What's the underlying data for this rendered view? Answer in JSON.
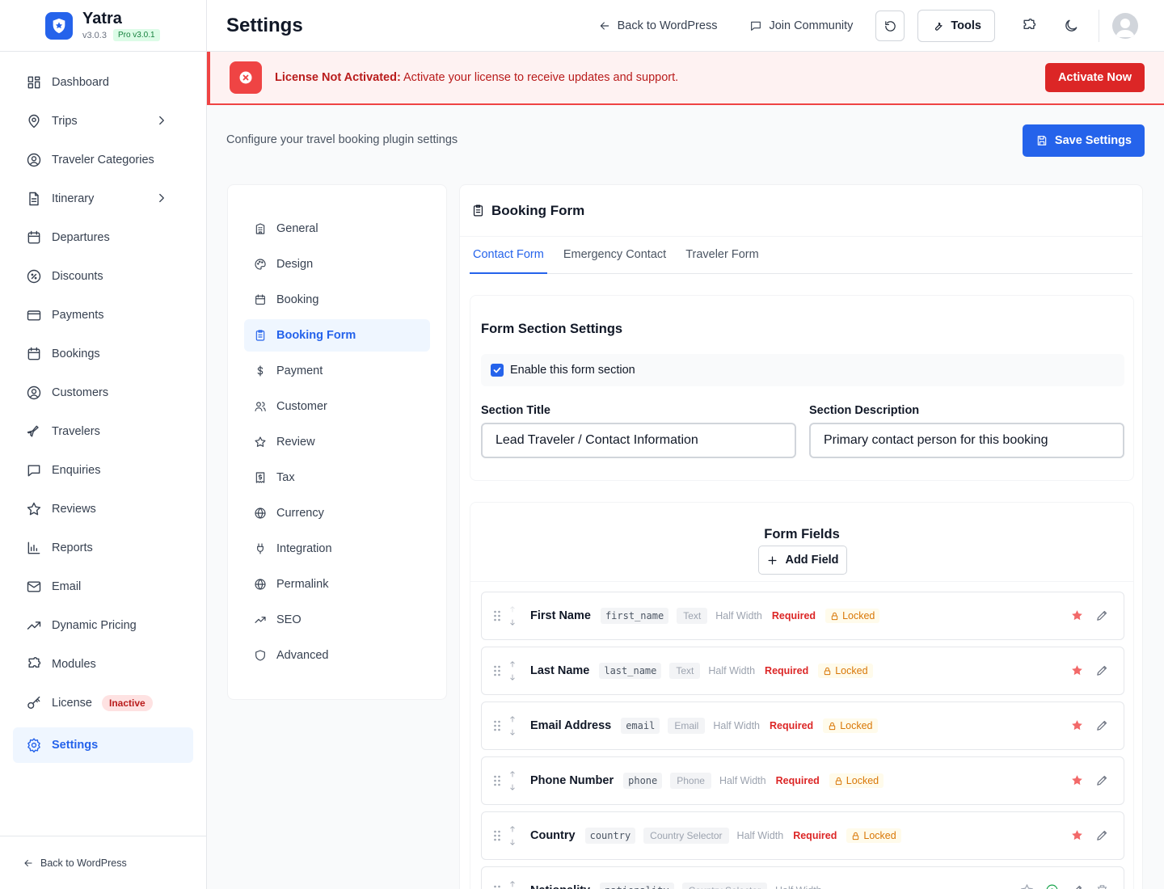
{
  "brand": {
    "name": "Yatra",
    "version": "v3.0.3",
    "pro": "Pro v3.0.1"
  },
  "sidebar": {
    "items": [
      {
        "label": "Dashboard",
        "icon": "dashboard-icon"
      },
      {
        "label": "Trips",
        "icon": "location-pin-icon",
        "chevron": true
      },
      {
        "label": "Traveler Categories",
        "icon": "user-circle-icon"
      },
      {
        "label": "Itinerary",
        "icon": "document-icon",
        "chevron": true
      },
      {
        "label": "Departures",
        "icon": "calendar-icon"
      },
      {
        "label": "Discounts",
        "icon": "discount-icon"
      },
      {
        "label": "Payments",
        "icon": "credit-card-icon"
      },
      {
        "label": "Bookings",
        "icon": "calendar-icon"
      },
      {
        "label": "Customers",
        "icon": "user-circle-icon"
      },
      {
        "label": "Travelers",
        "icon": "plane-icon"
      },
      {
        "label": "Enquiries",
        "icon": "message-icon"
      },
      {
        "label": "Reviews",
        "icon": "star-icon"
      },
      {
        "label": "Reports",
        "icon": "bar-chart-icon"
      },
      {
        "label": "Email",
        "icon": "mail-icon"
      },
      {
        "label": "Dynamic Pricing",
        "icon": "trend-icon"
      },
      {
        "label": "Modules",
        "icon": "puzzle-icon"
      },
      {
        "label": "License",
        "icon": "key-icon",
        "badge": "Inactive"
      },
      {
        "label": "Settings",
        "icon": "gear-icon",
        "active": true
      }
    ],
    "footer": "Back to WordPress"
  },
  "topbar": {
    "title": "Settings",
    "back": "Back to WordPress",
    "community": "Join Community",
    "tools": "Tools"
  },
  "alert": {
    "title": "License Not Activated:",
    "message": " Activate your license to receive updates and support.",
    "button": "Activate Now"
  },
  "main": {
    "subtitle": "Configure your travel booking plugin settings",
    "save": "Save Settings"
  },
  "settings_nav": [
    {
      "label": "General",
      "icon": "building-icon"
    },
    {
      "label": "Design",
      "icon": "palette-icon"
    },
    {
      "label": "Booking",
      "icon": "calendar-icon"
    },
    {
      "label": "Booking Form",
      "icon": "clipboard-icon",
      "active": true
    },
    {
      "label": "Payment",
      "icon": "dollar-icon"
    },
    {
      "label": "Customer",
      "icon": "users-icon"
    },
    {
      "label": "Review",
      "icon": "star-icon"
    },
    {
      "label": "Tax",
      "icon": "receipt-icon"
    },
    {
      "label": "Currency",
      "icon": "globe-icon"
    },
    {
      "label": "Integration",
      "icon": "plug-icon"
    },
    {
      "label": "Permalink",
      "icon": "globe-icon"
    },
    {
      "label": "SEO",
      "icon": "trend-icon"
    },
    {
      "label": "Advanced",
      "icon": "shield-icon"
    }
  ],
  "panel": {
    "title": "Booking Form",
    "tabs": [
      "Contact Form",
      "Emergency Contact",
      "Traveler Form"
    ],
    "section": {
      "title": "Form Section Settings",
      "enable_label": "Enable this form section",
      "enabled": true,
      "title_label": "Section Title",
      "title_value": "Lead Traveler / Contact Information",
      "desc_label": "Section Description",
      "desc_value": "Primary contact person for this booking"
    },
    "fields": {
      "title": "Form Fields",
      "add": "Add Field",
      "rows": [
        {
          "name": "First Name",
          "key": "first_name",
          "type": "Text",
          "width": "Half Width",
          "required": "Required",
          "locked": "Locked"
        },
        {
          "name": "Last Name",
          "key": "last_name",
          "type": "Text",
          "width": "Half Width",
          "required": "Required",
          "locked": "Locked"
        },
        {
          "name": "Email Address",
          "key": "email",
          "type": "Email",
          "width": "Half Width",
          "required": "Required",
          "locked": "Locked"
        },
        {
          "name": "Phone Number",
          "key": "phone",
          "type": "Phone",
          "width": "Half Width",
          "required": "Required",
          "locked": "Locked"
        },
        {
          "name": "Country",
          "key": "country",
          "type": "Country Selector",
          "width": "Half Width",
          "required": "Required",
          "locked": "Locked"
        },
        {
          "name": "Nationality",
          "key": "nationality",
          "type": "Country Selector",
          "width": "Half Width"
        }
      ]
    }
  },
  "colors": {
    "primary": "#2563eb",
    "danger": "#dc2626",
    "warning": "#d97706"
  }
}
